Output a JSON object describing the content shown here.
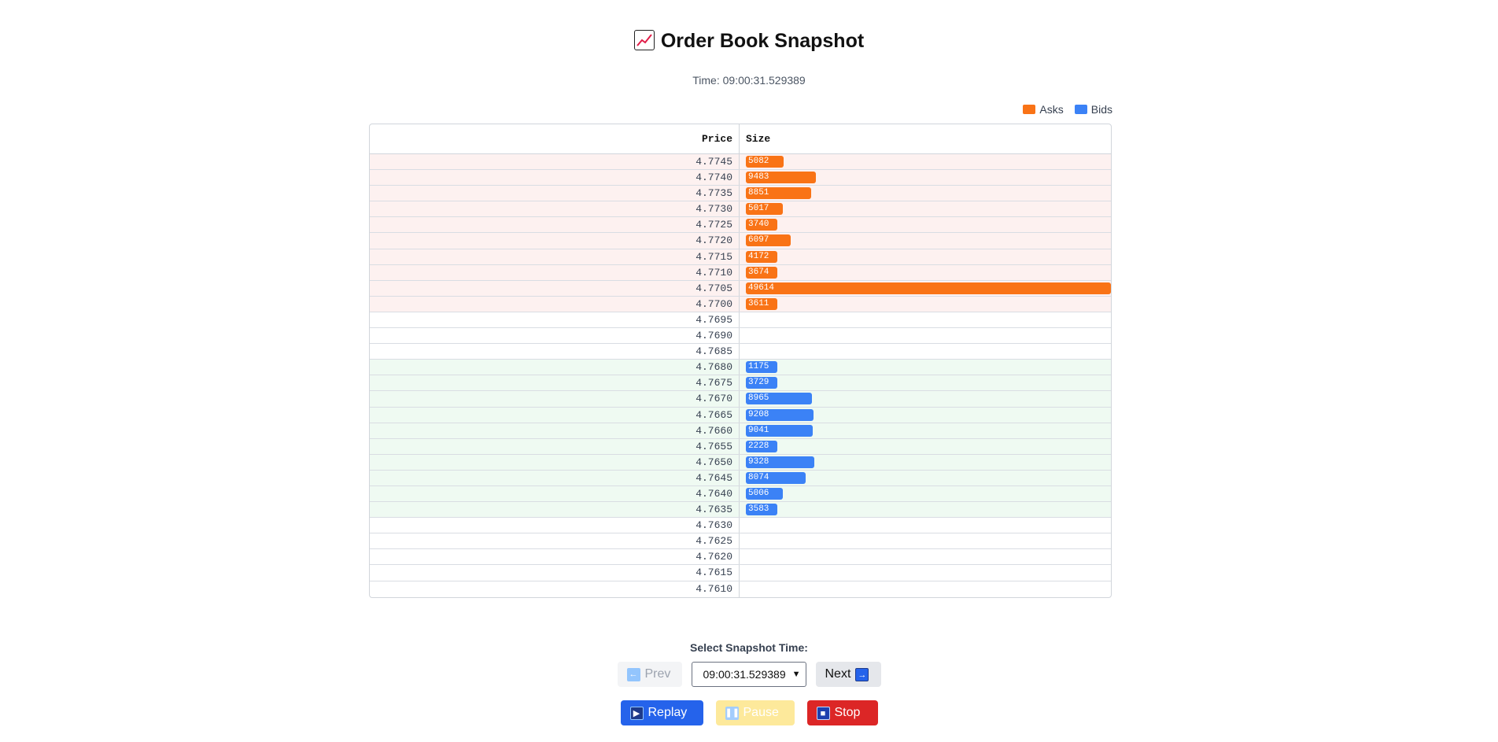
{
  "header": {
    "title": "Order Book Snapshot",
    "title_icon": "chart-increasing-icon",
    "time_label": "Time: 09:00:31.529389"
  },
  "legend": {
    "asks_label": "Asks",
    "bids_label": "Bids",
    "asks_color": "#f97316",
    "bids_color": "#3b82f6"
  },
  "table": {
    "price_header": "Price",
    "size_header": "Size",
    "max_size": 49614,
    "rows": [
      {
        "price": "4.7745",
        "side": "ask",
        "size": "5082"
      },
      {
        "price": "4.7740",
        "side": "ask",
        "size": "9483"
      },
      {
        "price": "4.7735",
        "side": "ask",
        "size": "8851"
      },
      {
        "price": "4.7730",
        "side": "ask",
        "size": "5017"
      },
      {
        "price": "4.7725",
        "side": "ask",
        "size": "3740"
      },
      {
        "price": "4.7720",
        "side": "ask",
        "size": "6097"
      },
      {
        "price": "4.7715",
        "side": "ask",
        "size": "4172"
      },
      {
        "price": "4.7710",
        "side": "ask",
        "size": "3674"
      },
      {
        "price": "4.7705",
        "side": "ask",
        "size": "49614"
      },
      {
        "price": "4.7700",
        "side": "ask",
        "size": "3611"
      },
      {
        "price": "4.7695",
        "side": "none",
        "size": ""
      },
      {
        "price": "4.7690",
        "side": "none",
        "size": ""
      },
      {
        "price": "4.7685",
        "side": "none",
        "size": ""
      },
      {
        "price": "4.7680",
        "side": "bid",
        "size": "1175"
      },
      {
        "price": "4.7675",
        "side": "bid",
        "size": "3729"
      },
      {
        "price": "4.7670",
        "side": "bid",
        "size": "8965"
      },
      {
        "price": "4.7665",
        "side": "bid",
        "size": "9208"
      },
      {
        "price": "4.7660",
        "side": "bid",
        "size": "9041"
      },
      {
        "price": "4.7655",
        "side": "bid",
        "size": "2228"
      },
      {
        "price": "4.7650",
        "side": "bid",
        "size": "9328"
      },
      {
        "price": "4.7645",
        "side": "bid",
        "size": "8074"
      },
      {
        "price": "4.7640",
        "side": "bid",
        "size": "5006"
      },
      {
        "price": "4.7635",
        "side": "bid",
        "size": "3583"
      },
      {
        "price": "4.7630",
        "side": "none",
        "size": ""
      },
      {
        "price": "4.7625",
        "side": "none",
        "size": ""
      },
      {
        "price": "4.7620",
        "side": "none",
        "size": ""
      },
      {
        "price": "4.7615",
        "side": "none",
        "size": ""
      },
      {
        "price": "4.7610",
        "side": "none",
        "size": ""
      }
    ]
  },
  "controls": {
    "select_label": "Select Snapshot Time:",
    "prev_label": "Prev",
    "next_label": "Next",
    "selected_time": "09:00:31.529389",
    "replay_label": "Replay",
    "pause_label": "Pause",
    "stop_label": "Stop"
  }
}
